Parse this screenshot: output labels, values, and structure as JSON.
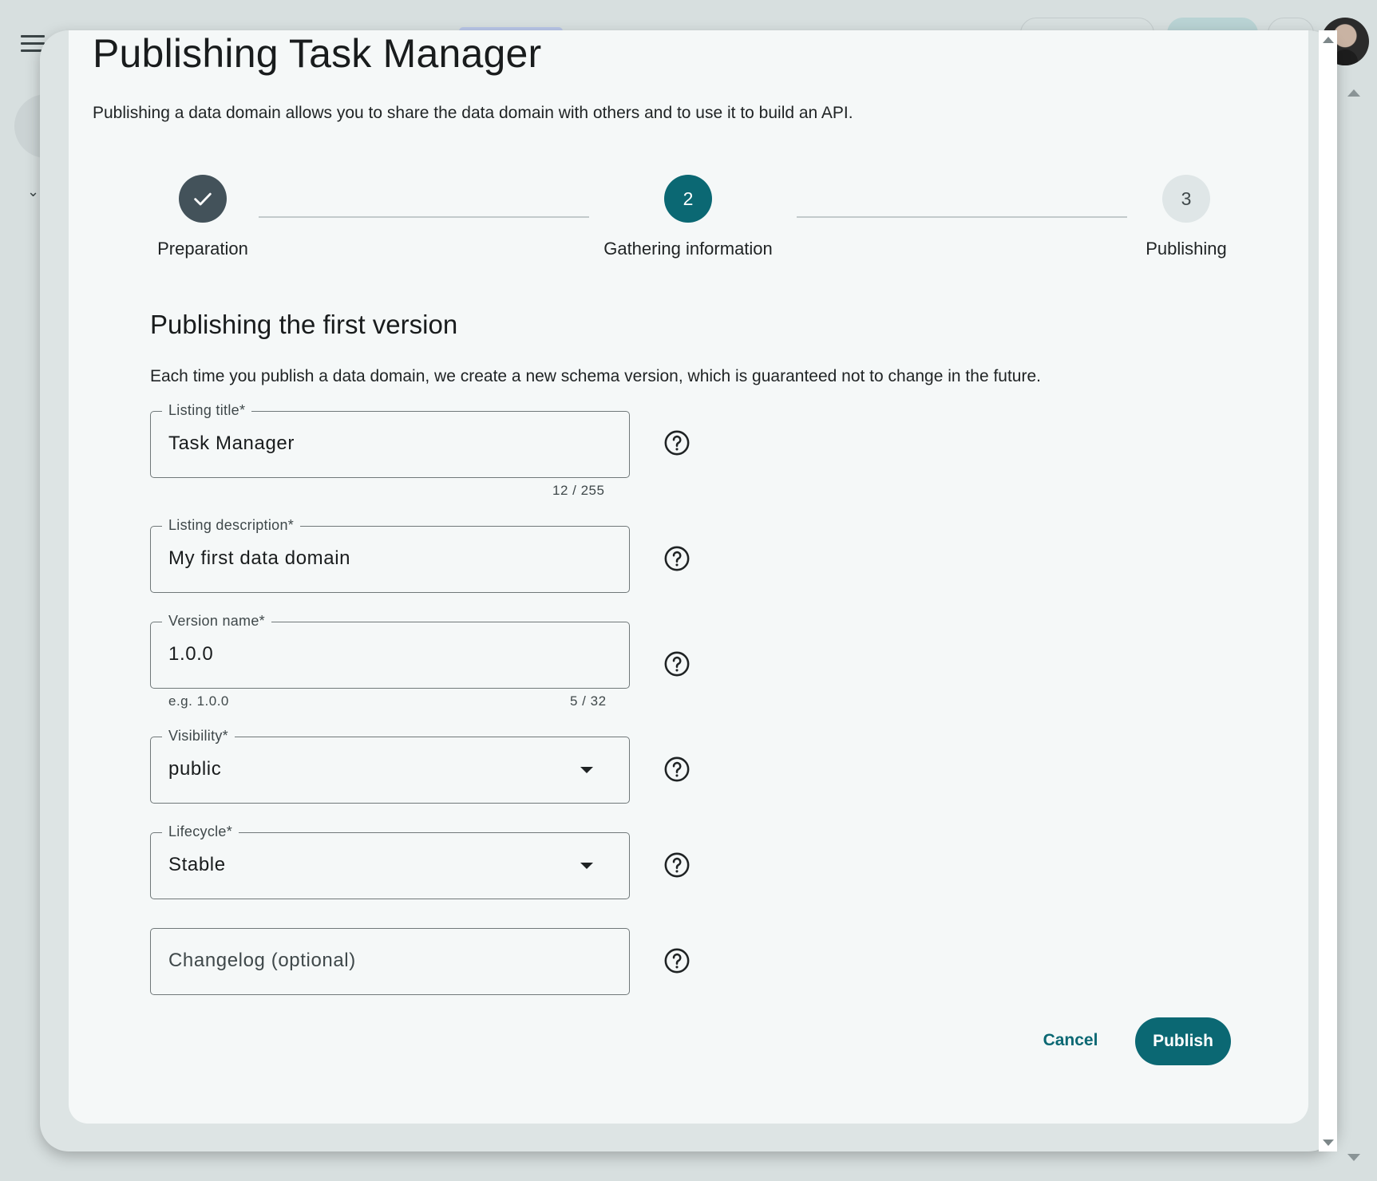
{
  "dialog": {
    "title": "Publishing Task Manager",
    "subtitle": "Publishing a data domain allows you to share the data domain with others and to use it to build an API."
  },
  "stepper": {
    "steps": [
      {
        "number": "1",
        "label": "Preparation",
        "state": "completed",
        "icon": "check-icon"
      },
      {
        "number": "2",
        "label": "Gathering information",
        "state": "active"
      },
      {
        "number": "3",
        "label": "Publishing",
        "state": "pending"
      }
    ]
  },
  "section": {
    "title": "Publishing the first version",
    "description": "Each time you publish a data domain, we create a new schema version, which is guaranteed not to change in the future."
  },
  "form": {
    "listing_title": {
      "label": "Listing title*",
      "value": "Task Manager",
      "counter": "12 / 255"
    },
    "listing_description": {
      "label": "Listing description*",
      "value": "My first data domain"
    },
    "version_name": {
      "label": "Version name*",
      "value": "1.0.0",
      "hint": "e.g. 1.0.0",
      "counter": "5 / 32"
    },
    "visibility": {
      "label": "Visibility*",
      "value": "public"
    },
    "lifecycle": {
      "label": "Lifecycle*",
      "value": "Stable"
    },
    "changelog": {
      "placeholder": "Changelog (optional)"
    }
  },
  "actions": {
    "cancel_label": "Cancel",
    "publish_label": "Publish"
  },
  "colors": {
    "primary": "#0b6873",
    "completed_step": "#43525a",
    "pending_step": "#dfe6e7",
    "dialog_bg": "#f5f8f8"
  }
}
